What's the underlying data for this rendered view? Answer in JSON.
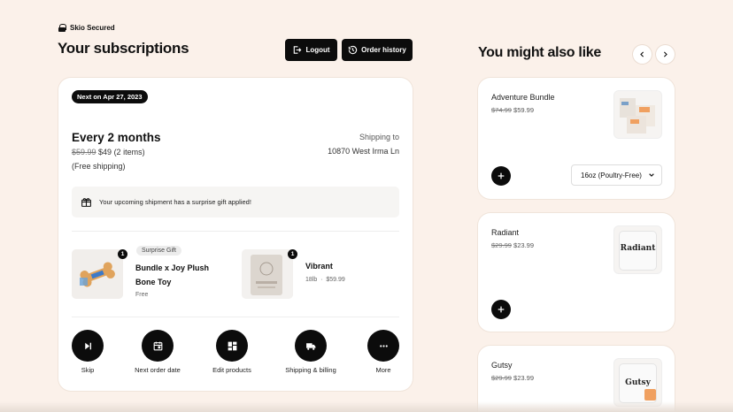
{
  "header": {
    "secured_label": "Skio Secured",
    "title": "Your subscriptions",
    "logout_label": "Logout",
    "history_label": "Order history"
  },
  "subscription": {
    "next_date": "Next on Apr 27, 2023",
    "frequency": "Every 2 months",
    "old_price": "$59.99",
    "new_price": "$49 (2 items)",
    "shipping_note": "(Free shipping)",
    "shipping_to_label": "Shipping to",
    "shipping_address": "10870 West Irma Ln",
    "gift_message": "Your upcoming shipment has a surprise gift applied!",
    "items": [
      {
        "qty": "1",
        "tag": "Surprise Gift",
        "name_line1": "Bundle x Joy Plush",
        "name_line2": "Bone Toy",
        "meta": "Free"
      },
      {
        "qty": "1",
        "name_line1": "Vibrant",
        "meta_size": "18lb",
        "meta_sep": "·",
        "meta_price": "$59.99"
      }
    ],
    "actions": [
      {
        "label": "Skip",
        "icon": "skip-next-icon"
      },
      {
        "label": "Next order date",
        "icon": "calendar-icon"
      },
      {
        "label": "Edit products",
        "icon": "dashboard-icon"
      },
      {
        "label": "Shipping & billing",
        "icon": "truck-icon"
      },
      {
        "label": "More",
        "icon": "more-horizontal-icon"
      }
    ]
  },
  "recommendations": {
    "title": "You might also like",
    "items": [
      {
        "name": "Adventure Bundle",
        "old_price": "$74.99",
        "new_price": "$59.99",
        "variant": "16oz (Poultry-Free)"
      },
      {
        "name": "Radiant",
        "old_price": "$29.99",
        "new_price": "$23.99",
        "label_text": "Radiant"
      },
      {
        "name": "Gutsy",
        "old_price": "$29.99",
        "new_price": "$23.99",
        "label_text": "Gutsy"
      }
    ]
  },
  "colors": {
    "background": "#fbf1ea",
    "primary": "#0c0c0c",
    "card": "#ffffff",
    "accent_orange": "#f0a060"
  }
}
